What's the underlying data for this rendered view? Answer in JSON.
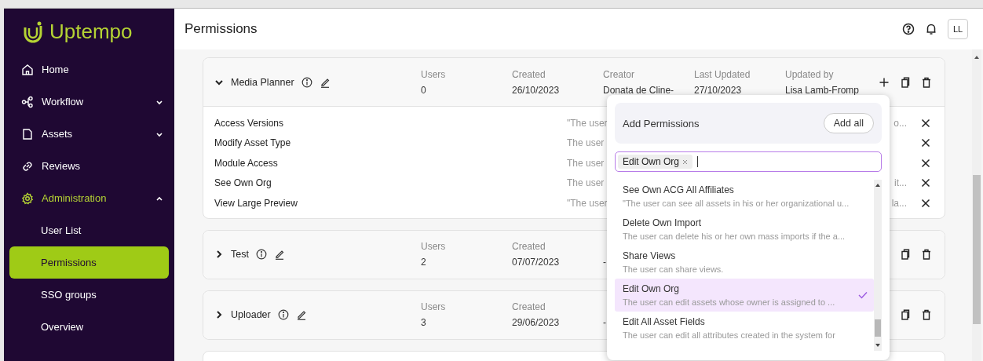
{
  "app": {
    "logo": "Uptempo"
  },
  "sidebar": {
    "items": [
      {
        "label": "Home",
        "kind": "link",
        "selected": false
      },
      {
        "label": "Workflow",
        "kind": "group",
        "expanded": false,
        "selected": false
      },
      {
        "label": "Assets",
        "kind": "group",
        "expanded": false,
        "selected": false
      },
      {
        "label": "Reviews",
        "kind": "link",
        "selected": false
      },
      {
        "label": "Administration",
        "kind": "group",
        "expanded": true,
        "selected": true,
        "children": [
          {
            "label": "User List",
            "selected": false
          },
          {
            "label": "Permissions",
            "selected": true
          },
          {
            "label": "SSO groups",
            "selected": false
          },
          {
            "label": "Overview",
            "selected": false
          }
        ]
      }
    ]
  },
  "header": {
    "title": "Permissions",
    "avatar": "LL"
  },
  "roles": [
    {
      "name": "Media Planner",
      "expanded": true,
      "columns": [
        {
          "label": "Users",
          "value": "0"
        },
        {
          "label": "Created",
          "value": "26/10/2023"
        },
        {
          "label": "Creator",
          "value": "Donata de Cline-"
        },
        {
          "label": "Last Updated",
          "value": "27/10/2023"
        },
        {
          "label": "Updated by",
          "value": "Lisa Lamb-Fromp"
        }
      ],
      "actions": [
        {
          "kind": "add"
        },
        {
          "kind": "copy"
        },
        {
          "kind": "delete"
        }
      ],
      "permissions": [
        {
          "name": "Access Versions",
          "description": "\"The user",
          "tail": "o..."
        },
        {
          "name": "Modify Asset Type",
          "description": "The user"
        },
        {
          "name": "Module Access",
          "description": "The user"
        },
        {
          "name": "See Own Org",
          "description": "The user",
          "tail": "it..."
        },
        {
          "name": "View Large Preview",
          "description": "\"The user",
          "tail": "la..."
        }
      ]
    },
    {
      "name": "Test",
      "expanded": false,
      "columns": [
        {
          "label": "Users",
          "value": "2"
        },
        {
          "label": "Created",
          "value": "07/07/2023"
        },
        {
          "value": "-"
        }
      ],
      "actions": [
        {
          "kind": "copy"
        },
        {
          "kind": "delete"
        }
      ]
    },
    {
      "name": "Uploader",
      "expanded": false,
      "columns": [
        {
          "label": "Users",
          "value": "3"
        },
        {
          "label": "Created",
          "value": "29/06/2023"
        },
        {
          "value": "-"
        }
      ],
      "actions": [
        {
          "kind": "copy"
        },
        {
          "kind": "delete"
        }
      ]
    }
  ],
  "add_permissions": {
    "title": "Add Permissions",
    "add_all": "Add all",
    "chips": [
      "Edit Own Org"
    ],
    "options": [
      {
        "title": "See Own ACG All Affiliates",
        "description": "\"The user can see all assets in his or her organizational u...",
        "selected": false
      },
      {
        "title": "Delete Own Import",
        "description": "The user can delete his or her own mass imports if the a...",
        "selected": false
      },
      {
        "title": "Share Views",
        "description": "The user can share views.",
        "selected": false
      },
      {
        "title": "Edit Own Org",
        "description": "The user can edit assets whose owner is assigned to ...",
        "selected": true
      },
      {
        "title": "Edit All Asset Fields",
        "description": "The user can edit all attributes created in the system for",
        "selected": false
      }
    ]
  }
}
